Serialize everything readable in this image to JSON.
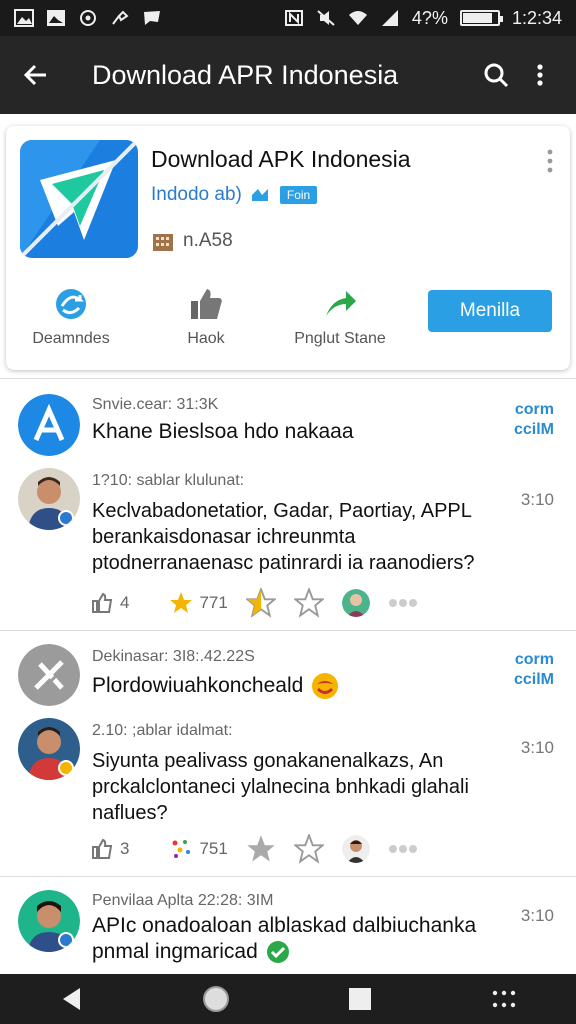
{
  "status_bar": {
    "battery_text": "4?%",
    "time": "1:2:34",
    "battery_level": 0.85,
    "icons_left": [
      "image-icon",
      "gallery-icon",
      "sync-icon",
      "brush-icon",
      "chat-icon"
    ],
    "icons_right": [
      "nfc-icon",
      "mute-icon",
      "wifi-icon",
      "signal-icon"
    ]
  },
  "app_bar": {
    "title": "Download APR Indonesia"
  },
  "app_card": {
    "title": "Download APK Indonesia",
    "subtitle": "Indodo ab)",
    "badge": "Foin",
    "size": "n.A58",
    "actions": [
      {
        "label": "Deamndes",
        "icon": "share-icon"
      },
      {
        "label": "Haok",
        "icon": "thumbs-up-icon"
      },
      {
        "label": "Pnglut Stane",
        "icon": "forward-arrow-icon"
      }
    ],
    "install_label": "Menilla",
    "colors": {
      "accent": "#2a9fe4",
      "logo_green": "#1fc9a0",
      "logo_blue": "#1c7fe0"
    }
  },
  "posts": [
    {
      "channel_meta": "Snvie.cear: 31:3K",
      "channel_heading": "Khane Bieslsoa hdo nakaaa",
      "side_tag": "corm\nccilM",
      "reply_meta": "1?10: sablar klulunat:",
      "time": "3:10",
      "body": "Keclvabadonetatior, Gadar, Paortiay, APPL berankaisdonasar ichreunmta ptodnerranaenasc patinrardi ia raanodiers?",
      "stats": {
        "comments": "4",
        "rating": "771"
      },
      "icons": [
        "brand-a-icon"
      ]
    },
    {
      "channel_meta": "Dekinasar: 3I8:.42.22S",
      "channel_heading": "Plordowiuahkoncheald",
      "side_tag": "corm\nccilM",
      "reply_meta": "2.10: ;ablar idalmat:",
      "time": "3:10",
      "body": "Siyunta pealivass gonakanenalkazs, An prckalclontaneci ylalnecina bnhkadi glahali naflues?",
      "stats": {
        "comments": "3",
        "rating": "751"
      },
      "icons": [
        "brand-x-icon"
      ]
    },
    {
      "channel_meta": "Penvilaa Aplta 22:28: 3IM",
      "channel_heading": "APIc onadoaloan alblaskad dalbiuchanka",
      "channel_heading_2": "pnmal ingmaricad",
      "time": "3:10"
    }
  ]
}
